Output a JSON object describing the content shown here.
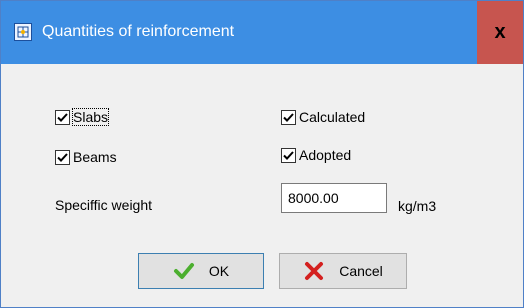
{
  "window": {
    "title": "Quantities of reinforcement",
    "title_icon": "app-icon",
    "close_label": "x"
  },
  "options": {
    "slabs": {
      "label": "Slabs",
      "checked": true
    },
    "beams": {
      "label": "Beams",
      "checked": true
    },
    "calculated": {
      "label": "Calculated",
      "checked": true
    },
    "adopted": {
      "label": "Adopted",
      "checked": true
    }
  },
  "weight": {
    "label": "Speciffic weight",
    "value": "8000.00",
    "unit": "kg/m3"
  },
  "buttons": {
    "ok": {
      "label": "OK",
      "icon": "checkmark-icon"
    },
    "cancel": {
      "label": "Cancel",
      "icon": "x-icon"
    }
  },
  "colors": {
    "title_bar": "#3d8ee3",
    "close": "#c7554f",
    "ok_check": "#4caf2f",
    "cancel_x": "#d4201f"
  }
}
